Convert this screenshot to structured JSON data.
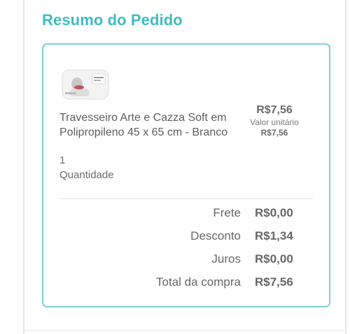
{
  "order_summary": {
    "title": "Resumo do Pedido",
    "product": {
      "name": "Travesseiro Arte e Cazza Soft em Polipropileno 45 x 65 cm - Branco",
      "quantity_value": "1",
      "quantity_label": "Quantidade",
      "price": "R$7,56",
      "unit_price_label": "Valor unitário",
      "unit_price": "R$7,56"
    },
    "totals": [
      {
        "label": "Frete",
        "value": "R$0,00"
      },
      {
        "label": "Desconto",
        "value": "R$1,34"
      },
      {
        "label": "Juros",
        "value": "R$0,00"
      },
      {
        "label": "Total da compra",
        "value": "R$7,56"
      }
    ]
  },
  "colors": {
    "accent": "#3fbcc0",
    "card_border": "#7fd0d3",
    "text": "#5b5b5b"
  }
}
